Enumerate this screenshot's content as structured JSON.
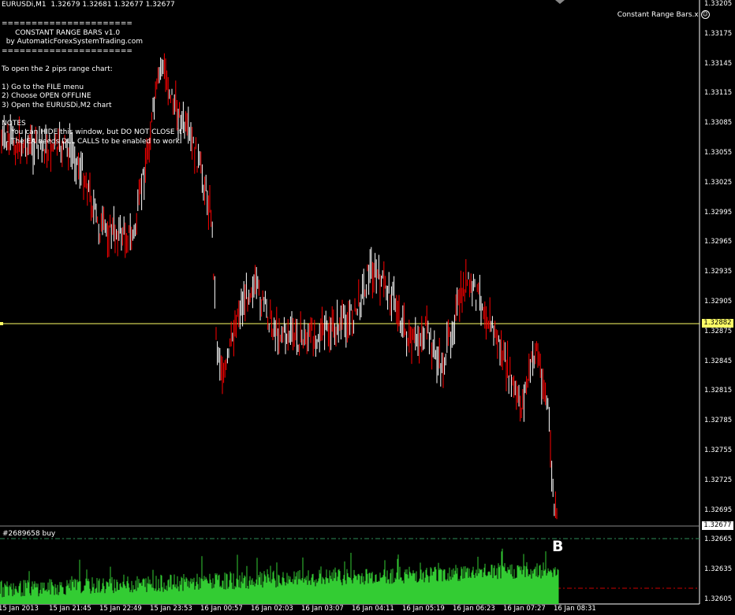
{
  "header": {
    "symbol_info": "EURUSDi,M1  1.32679 1.32681 1.32677 1.32677",
    "indicator_name": "Constant Range Bars.x",
    "indicator_icon": "smiley-icon"
  },
  "info_text": {
    "lines": [
      "======================",
      "      CONSTANT RANGE BARS v1.0",
      "  by AutomaticForexSystemTrading.com",
      "======================",
      "",
      "To open the 2 pips range chart:",
      "",
      "1) Go to the FILE menu",
      "2) Choose OPEN OFFLINE",
      "3) Open the EURUSDi,M2 chart",
      "",
      "NOTES",
      "  - You can HIDE this window, but DO NOT CLOSE it",
      "  - The EA needs DLL CALLS to be enabled to work."
    ]
  },
  "price_axis": {
    "labels": [
      "1.33205",
      "1.33175",
      "1.33145",
      "1.33115",
      "1.33085",
      "1.33055",
      "1.33025",
      "1.32995",
      "1.32965",
      "1.32935",
      "1.32905",
      "1.32875",
      "1.32845",
      "1.32815",
      "1.32785",
      "1.32755",
      "1.32725",
      "1.32695",
      "1.32665",
      "1.32635",
      "1.32605"
    ],
    "hline_price": "1.32882",
    "current_price": "1.32677"
  },
  "time_axis": {
    "labels": [
      "15 Jan 2013",
      "15 Jan 21:45",
      "15 Jan 22:49",
      "15 Jan 23:53",
      "16 Jan 00:57",
      "16 Jan 02:03",
      "16 Jan 03:07",
      "16 Jan 04:11",
      "16 Jan 05:19",
      "16 Jan 06:23",
      "16 Jan 07:27",
      "16 Jan 08:31"
    ]
  },
  "order": {
    "label": "#2689658 buy",
    "marker": "B"
  },
  "colors": {
    "background": "#000000",
    "bar_up": "#ffffff",
    "bar_down": "#ff0000",
    "hline": "#ffff66",
    "volume": "#33cc33",
    "order_line": "#2e8b57",
    "stop_line": "#cc0000"
  }
}
